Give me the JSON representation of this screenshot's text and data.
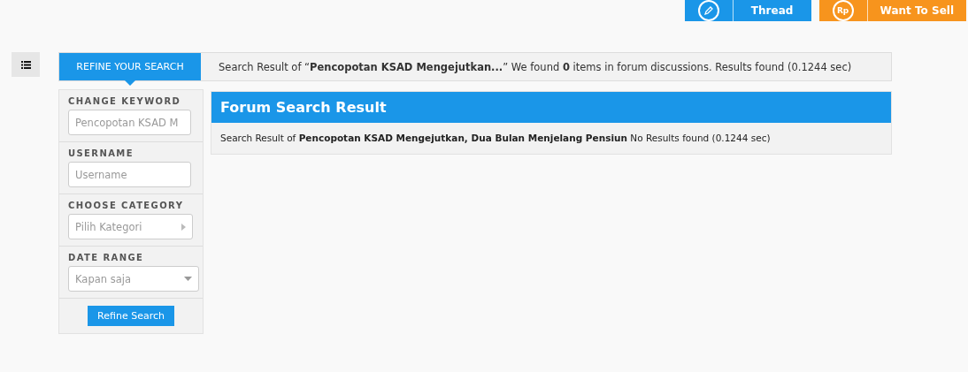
{
  "top_buttons": [
    {
      "kind": "pencil",
      "label": "Thread",
      "color": "#1a96e8"
    },
    {
      "kind": "rp",
      "icon_text": "Rp",
      "label": "Want To Sell",
      "color": "#f7941d"
    }
  ],
  "refine_tab": {
    "label": "REFINE YOUR SEARCH"
  },
  "summary": "Search Result of “**Pencopotan KSAD Mengejutkan...**” We found **0** items in forum discussions. Results found (0.1244 sec)",
  "filters": [
    {
      "label": "CHANGE KEYWORD",
      "kind": "text",
      "value": "Pencopotan KSAD M"
    },
    {
      "label": "USERNAME",
      "kind": "text",
      "placeholder": "Username"
    },
    {
      "label": "CHOOSE CATEGORY",
      "kind": "menu",
      "value": "Pilih Kategori"
    },
    {
      "label": "DATE RANGE",
      "kind": "dropdown",
      "value": "Kapan saja"
    }
  ],
  "refine_button": "Refine Search",
  "result": {
    "title": "Forum Search Result",
    "message": "Search Result of **Pencopotan KSAD Mengejutkan, Dua Bulan Menjelang Pensiun** No Results found (0.1244 sec)"
  }
}
